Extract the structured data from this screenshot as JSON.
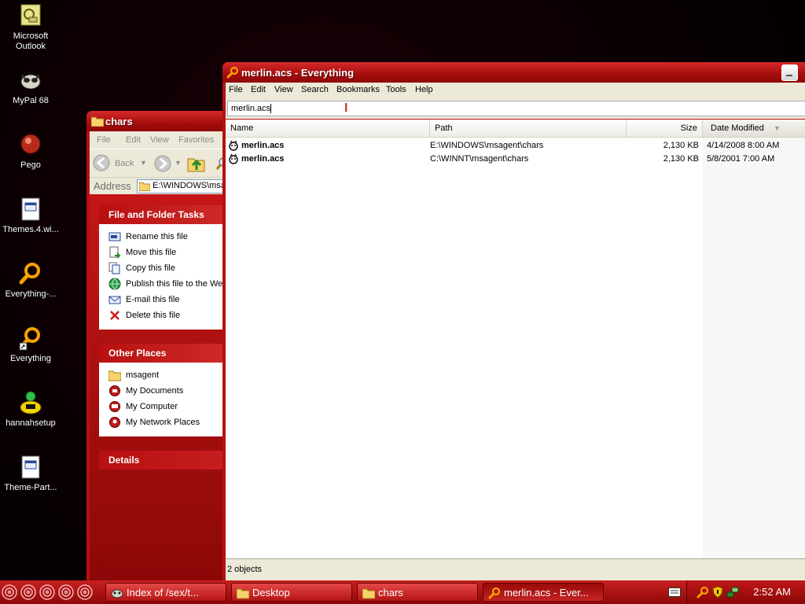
{
  "desktop": {
    "icons": [
      {
        "label": "Microsoft\nOutlook",
        "icon": "outlook-icon"
      },
      {
        "label": "MyPal 68",
        "icon": "mypal-icon"
      },
      {
        "label": "Pego",
        "icon": "pego-icon"
      },
      {
        "label": "Themes.4.wi...",
        "icon": "theme-file-icon"
      },
      {
        "label": "Everything-...",
        "icon": "everything-icon"
      },
      {
        "label": "Everything",
        "icon": "everything-icon"
      },
      {
        "label": "hannahsetup",
        "icon": "hannah-icon"
      },
      {
        "label": "Theme-Part...",
        "icon": "theme-file-icon"
      }
    ]
  },
  "explorer": {
    "title": "chars",
    "menu": [
      "File",
      "Edit",
      "View",
      "Favorites"
    ],
    "back_label": "Back",
    "address_label": "Address",
    "address_value": "E:\\WINDOWS\\msagent\\chars",
    "file_tasks": {
      "title": "File and Folder Tasks",
      "items": [
        "Rename this file",
        "Move this file",
        "Copy this file",
        "Publish this file to the Web",
        "E-mail this file",
        "Delete this file"
      ]
    },
    "other_places": {
      "title": "Other Places",
      "items": [
        "msagent",
        "My Documents",
        "My Computer",
        "My Network Places"
      ]
    },
    "details_title": "Details"
  },
  "everything": {
    "title": "merlin.acs - Everything",
    "menu": [
      "File",
      "Edit",
      "View",
      "Search",
      "Bookmarks",
      "Tools",
      "Help"
    ],
    "search_value": "merlin.acs",
    "columns": [
      "Name",
      "Path",
      "Size",
      "Date Modified"
    ],
    "rows": [
      {
        "name": "merlin.acs",
        "path": "E:\\WINDOWS\\msagent\\chars",
        "size": "2,130 KB",
        "date": "4/14/2008 8:00 AM"
      },
      {
        "name": "merlin.acs",
        "path": "C:\\WINNT\\msagent\\chars",
        "size": "2,130 KB",
        "date": "5/8/2001 7:00 AM"
      }
    ],
    "status": "2 objects"
  },
  "taskbar": {
    "tasks": [
      {
        "label": "Index of /sex/t...",
        "active": false
      },
      {
        "label": "Desktop",
        "active": false
      },
      {
        "label": "chars",
        "active": false
      },
      {
        "label": "merlin.acs - Ever...",
        "active": true
      }
    ],
    "clock": "2:52 AM"
  },
  "colors": {
    "accent": "#b61111",
    "panel": "#ece9d8",
    "highlight_icon": "#f5a100"
  }
}
